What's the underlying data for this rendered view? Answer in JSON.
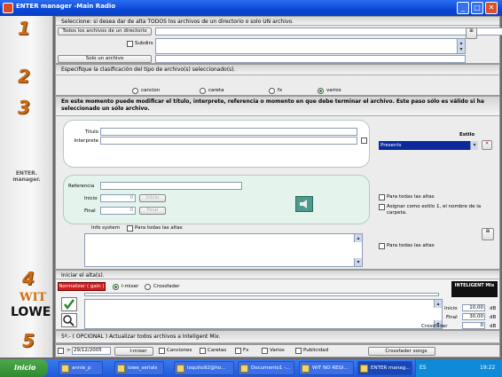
{
  "window": {
    "title": "ENTER manager  -Main Radio"
  },
  "sidebar": {
    "steps": [
      "1",
      "2",
      "3",
      "4",
      "5"
    ],
    "logo": "ENTER. manager.",
    "brand_top": "WIT",
    "brand_bottom": "LOWE"
  },
  "section1": {
    "header": "Seleccione: si desea dar de alta TODOS los archivos de un directorio o solo UN archivo.",
    "all_files_button": "Todos los archivos de un directorio",
    "subdirs_label": "Subdirs",
    "one_file_button": "Solo un archivo"
  },
  "section2": {
    "header": "Especifique la clasificación del tipo de archivo(s) seleccionado(s).",
    "options": [
      "cancion",
      "careta",
      "fx",
      "varios"
    ],
    "selected": "varios"
  },
  "section3": {
    "header": "En este momento puede modificar el título, interprete, referencia o momento en que debe terminar el archivo. Este paso sólo es válido si ha seleccionado un sólo archivo.",
    "titulo_label": "Titulo",
    "interprete_label": "Interprete",
    "estilo_label": "Estilo",
    "estilo_value": "Presents",
    "referencia_label": "Referencia",
    "inicio_label": "Inicio",
    "inicio_value": "0",
    "inicio_button": "Inicio",
    "final_label": "Final",
    "final_value": "0",
    "final_button": "Final",
    "para_todas_1": "Para todas las altas",
    "asignar_estilo": "Asignar como estilo 1, el nombre de la carpeta.",
    "info_system_label": "Info system",
    "para_todas_info": "Para todas las altas",
    "para_todas_2": "Para todas las altas"
  },
  "section4": {
    "header": "Iniciar el alta(s).",
    "normalizer_button": "Normalizer ( gain )",
    "mode_options": [
      "I-mixer",
      "Crossfader"
    ],
    "mode_selected": "I-mixer",
    "brand_badge": "INTELIGENT Mix",
    "inicio_label": "Inicio",
    "inicio_value": "10,00",
    "final_label": "Final",
    "final_value": "30,00",
    "crossfader_label": "Crossfader",
    "crossfader_value": "0",
    "unit": "dB"
  },
  "section5": {
    "header": "5º.- ( OPCIONAL ) Actualizar todos archivos a Inteligent Mix.",
    "date_prefix": ">",
    "date_value": "29/12/2005",
    "imixer_button": "I-mixer",
    "filters": [
      "Canciones",
      "Caretas",
      "Fx",
      "Varios",
      "Publicidad"
    ],
    "crossfader_songs_button": "Crossfader songs"
  },
  "taskbar": {
    "start_label": "Inicio",
    "tasks": [
      "annie_p",
      "lowe_serials",
      "loquito92@ho...",
      "Documento1 -...",
      "WIT NO REGI...",
      "ENTER manag..."
    ],
    "active_task": "ENTER manag...",
    "language": "ES",
    "clock": "19:22"
  },
  "colors": {
    "titlebar": "#0a47d6",
    "step_numbers": "#c96a18",
    "section3_field_bg": "#e4f4ec",
    "estilo_select": "#0b2a9e",
    "normalizer": "#cc1f1f",
    "taskbar": "#1f5ad8",
    "start_button": "#2f8a2f"
  }
}
